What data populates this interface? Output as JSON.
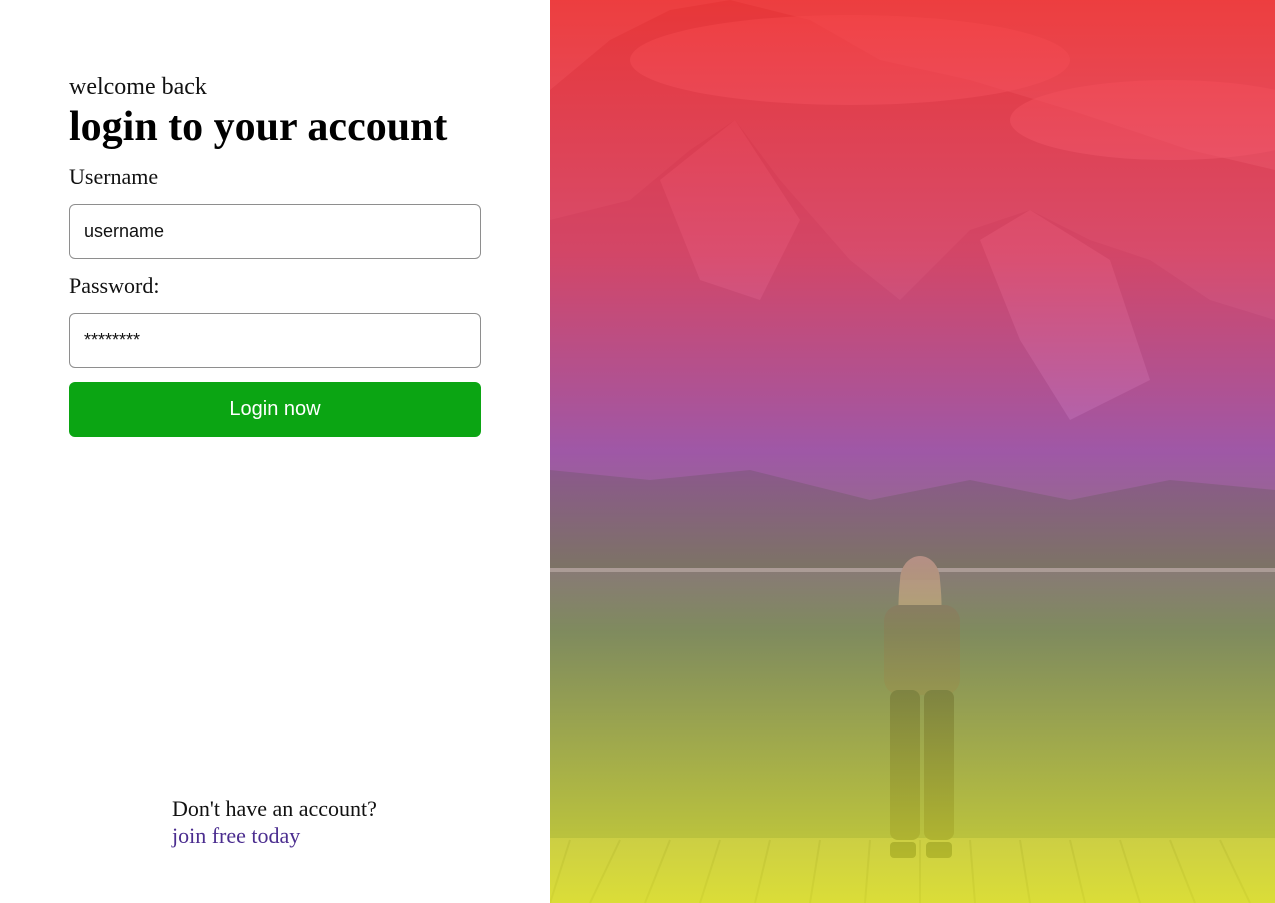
{
  "login": {
    "welcome": "welcome back",
    "title": "login to your account",
    "username_label": "Username",
    "username_value": "username",
    "password_label": "Password:",
    "password_value": "********",
    "submit_label": "Login now"
  },
  "signup": {
    "prompt": "Don't have an account?",
    "link_label": "join free today"
  },
  "hero": {
    "image_subject": "person standing on dock facing mountain lake",
    "overlay_colors": [
      "#ff2828",
      "#f53c64",
      "#be50c8",
      "#96a05a",
      "#e6eb28"
    ]
  },
  "colors": {
    "accent": "#0ba513",
    "link": "#4b2d8f"
  }
}
